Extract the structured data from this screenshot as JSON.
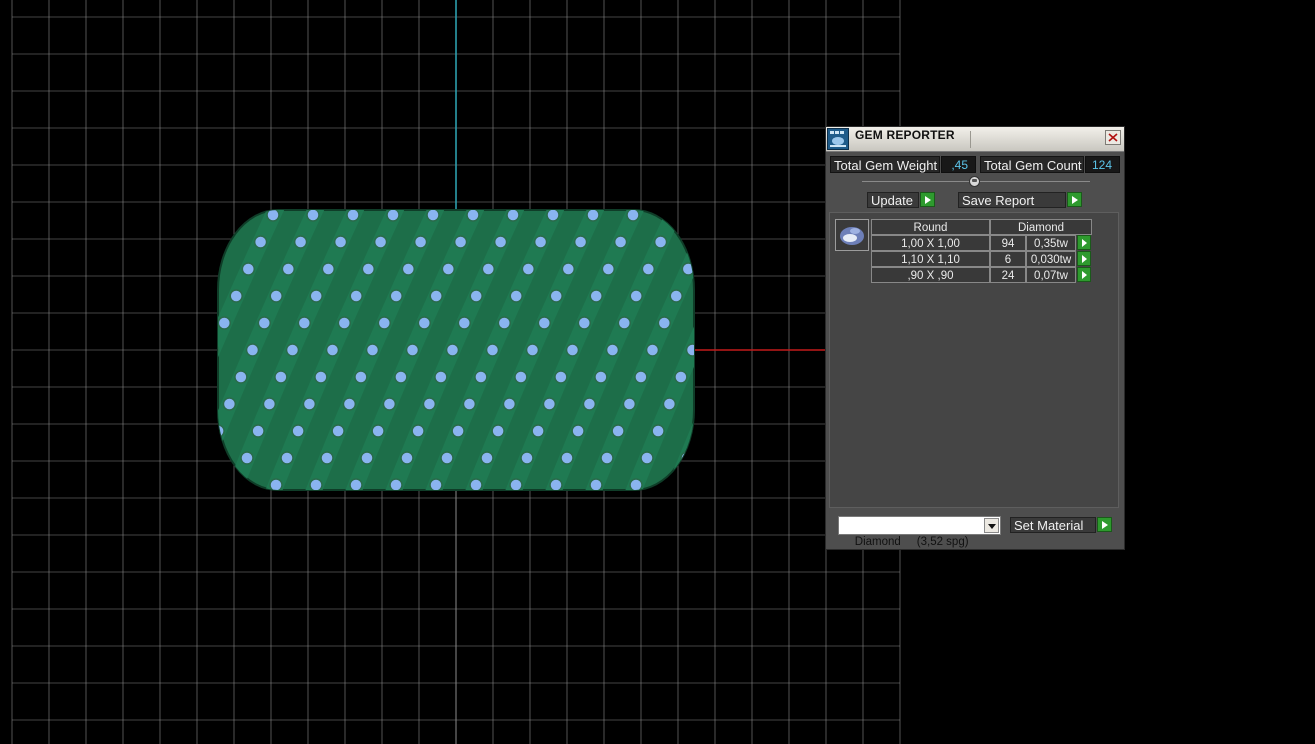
{
  "gem_reporter": {
    "title": "GEM REPORTER",
    "total_gem_weight_label": "Total Gem Weight",
    "total_gem_weight_value": ",45",
    "total_gem_count_label": "Total Gem Count",
    "total_gem_count_value": "124",
    "update_label": "Update",
    "save_report_label": "Save Report",
    "table": {
      "headers": [
        "Round",
        "Diamond"
      ],
      "rows": [
        {
          "size": "1,00 X 1,00",
          "count": "94",
          "weight": "0,35tw"
        },
        {
          "size": "1,10 X 1,10",
          "count": "6",
          "weight": "0,030tw"
        },
        {
          "size": ",90 X ,90",
          "count": "24",
          "weight": "0,07tw"
        }
      ]
    },
    "material_select": {
      "value": "Diamond     (3,52 spg)"
    },
    "set_material_label": "Set Material"
  },
  "colors": {
    "viewport_bg": "#000000",
    "grid": "#8a8a8a",
    "axis_vertical": "#2fa8b8",
    "axis_horizontal": "#c21a1a",
    "ring_metal": "#1f7a52",
    "gems": "#8ab4f0",
    "value_text": "#5cc5ea",
    "arrow_button": "#2e9a2e"
  },
  "icons": {
    "title": "gem-reporter-app-icon",
    "close": "close-icon",
    "gem_thumbnail": "round-gem-icon",
    "row_action": "play-arrow-icon",
    "dropdown": "chevron-down-icon"
  }
}
